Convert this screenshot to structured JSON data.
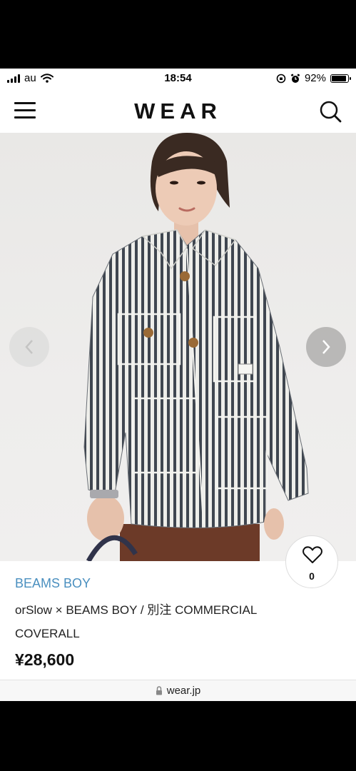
{
  "status_bar": {
    "carrier": "au",
    "time": "18:54",
    "battery_percent_label": "92%",
    "battery_level": 0.92,
    "icons": [
      "signal-icon",
      "wifi-icon",
      "orientation-lock-icon",
      "alarm-icon",
      "battery-icon"
    ]
  },
  "header": {
    "logo": "WEAR",
    "icons": [
      "menu-icon",
      "search-icon"
    ]
  },
  "gallery": {
    "image_subject": "model wearing striped coverall jacket",
    "icons": [
      "chevron-left-icon",
      "chevron-right-icon"
    ]
  },
  "like": {
    "count": "0",
    "icon": "heart-icon"
  },
  "product": {
    "brand": "BEAMS BOY",
    "name": "orSlow × BEAMS BOY / 別注 COMMERCIAL COVERALL",
    "price": "¥28,600"
  },
  "browser": {
    "url": "wear.jp",
    "icon": "lock-icon"
  },
  "colors": {
    "brand_link": "#4a8fbf",
    "text": "#111111",
    "background": "#ffffff"
  }
}
